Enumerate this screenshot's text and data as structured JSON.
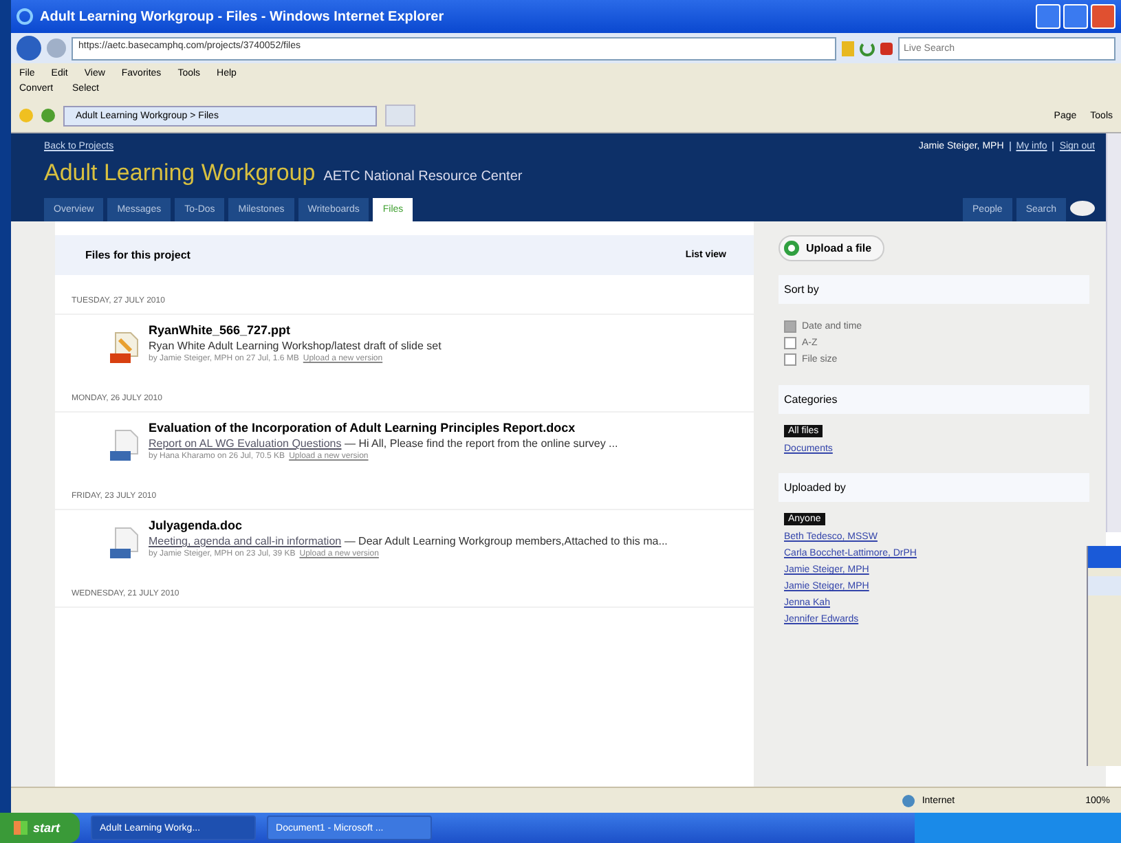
{
  "window": {
    "title": "Adult Learning Workgroup - Files - Windows Internet Explorer"
  },
  "address_bar": {
    "url": "https://aetc.basecamphq.com/projects/3740052/files",
    "search_placeholder": "Live Search"
  },
  "menu": [
    "File",
    "Edit",
    "View",
    "Favorites",
    "Tools",
    "Help"
  ],
  "toolbar": [
    "Convert",
    "Select"
  ],
  "browser_tab": {
    "title": "Adult Learning Workgroup > Files"
  },
  "command_bar": [
    "Page",
    "Tools"
  ],
  "page": {
    "back_link": "Back to Projects",
    "project": "Adult Learning Workgroup",
    "company": "AETC National Resource Center",
    "user": "Jamie Steiger, MPH",
    "user_links": [
      "My info",
      "Sign out"
    ],
    "tabs": [
      {
        "label": "Overview",
        "selected": false
      },
      {
        "label": "Messages",
        "selected": false
      },
      {
        "label": "To-Dos",
        "selected": false
      },
      {
        "label": "Milestones",
        "selected": false
      },
      {
        "label": "Writeboards",
        "selected": false
      },
      {
        "label": "Files",
        "selected": true
      }
    ],
    "right_tabs": [
      "People",
      "Search"
    ],
    "files_heading": "Files for this project",
    "view_link": "List view",
    "groups": [
      {
        "date": "TUESDAY, 27 JULY 2010",
        "files": [
          {
            "kind": "ppt",
            "name": "RyanWhite_566_727.ppt",
            "description": "Ryan White Adult Learning Workshop/latest draft of slide set",
            "meta": "by Jamie Steiger, MPH on 27 Jul, 1.6 MB",
            "action": "Upload a new version"
          }
        ]
      },
      {
        "date": "MONDAY, 26 JULY 2010",
        "files": [
          {
            "kind": "doc",
            "name": "Evaluation of the Incorporation of Adult Learning Principles Report.docx",
            "link": "Report on AL WG Evaluation Questions",
            "description": "— Hi All, Please find the report from the online survey ...",
            "meta": "by Hana Kharamo on 26 Jul, 70.5 KB",
            "action": "Upload a new version"
          }
        ]
      },
      {
        "date": "FRIDAY, 23 JULY 2010",
        "files": [
          {
            "kind": "doc",
            "name": "Julyagenda.doc",
            "link": "Meeting, agenda and call-in information",
            "description": "— Dear Adult Learning Workgroup members,Attached to this ma...",
            "meta": "by Jamie Steiger, MPH on 23 Jul, 39 KB",
            "action": "Upload a new version"
          }
        ]
      },
      {
        "date": "WEDNESDAY, 21 JULY 2010"
      }
    ],
    "upload_button": "Upload a file",
    "sort": {
      "heading": "Sort by",
      "options": [
        {
          "label": "Date and time",
          "selected": true
        },
        {
          "label": "A-Z",
          "selected": false
        },
        {
          "label": "File size",
          "selected": false
        }
      ]
    },
    "categories": {
      "heading": "Categories",
      "items": [
        {
          "label": "All files",
          "selected": true
        },
        {
          "label": "Documents",
          "selected": false
        }
      ]
    },
    "uploaded_by": {
      "heading": "Uploaded by",
      "items": [
        {
          "label": "Anyone",
          "selected": true
        },
        {
          "label": "Beth Tedesco, MSSW",
          "selected": false
        },
        {
          "label": "Carla Bocchet-Lattimore, DrPH",
          "selected": false
        },
        {
          "label": "Jamie Steiger, MPH",
          "selected": false
        },
        {
          "label": "Jamie Steiger, MPH",
          "selected": false
        },
        {
          "label": "Jenna Kah",
          "selected": false
        },
        {
          "label": "Jennifer Edwards",
          "selected": false
        }
      ]
    }
  },
  "status_bar": {
    "zone": "Internet",
    "zoom": "100%"
  },
  "taskbar": {
    "start": "start",
    "buttons": [
      {
        "label": "Adult Learning Workg...",
        "selected": true
      },
      {
        "label": "Document1 - Microsoft ...",
        "selected": false
      }
    ]
  }
}
